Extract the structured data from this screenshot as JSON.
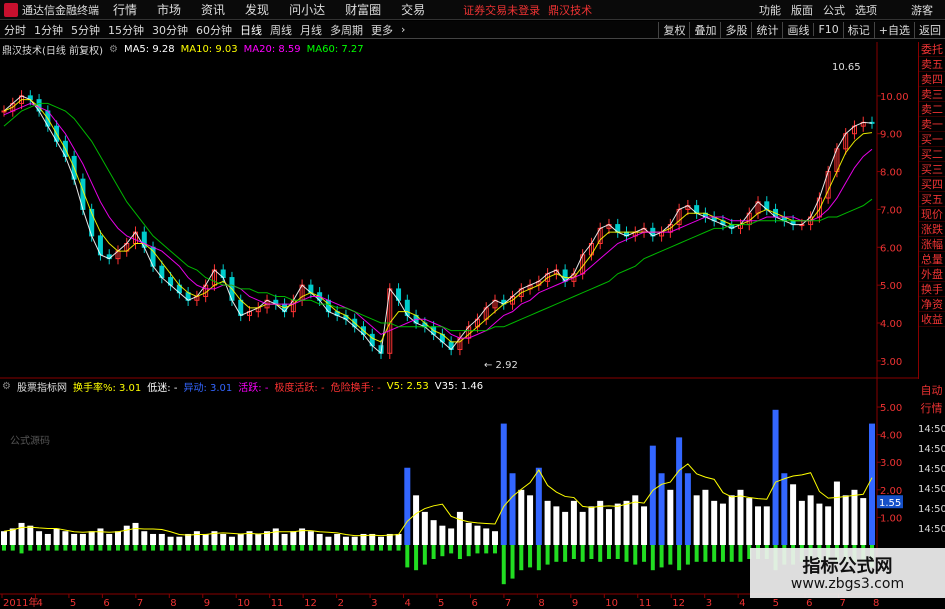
{
  "menubar": {
    "app_title": "通达信金融终端",
    "items": [
      "行情",
      "市场",
      "资讯",
      "发现",
      "问小达",
      "财富圈",
      "交易"
    ],
    "login_status": "证券交易未登录",
    "company": "鼎汉技术",
    "right_items": [
      "功能",
      "版面",
      "公式",
      "选项"
    ],
    "guest": "游客"
  },
  "toolbar": {
    "periods": [
      "分时",
      "1分钟",
      "5分钟",
      "15分钟",
      "30分钟",
      "60分钟",
      "日线",
      "周线",
      "月线",
      "多周期",
      "更多"
    ],
    "active": "日线",
    "right_buttons": [
      "复权",
      "叠加",
      "多股",
      "统计",
      "画线",
      "F10",
      "标记",
      "+自选",
      "返回"
    ]
  },
  "main_info": {
    "stock": "鼎汉技术(日线 前复权)",
    "ma5": "MA5: 9.28",
    "ma10": "MA10: 9.03",
    "ma20": "MA20: 8.59",
    "ma60": "MA60: 7.27"
  },
  "sub_info": {
    "name": "股票指标网",
    "turnover": "换手率%: 3.01",
    "low": "低迷: -",
    "move": "异动: 3.01",
    "active": "活跃: -",
    "very_active": "极度活跃: -",
    "warning": "危险换手: -",
    "v5": "V5: 2.53",
    "v35": "V35: 1.46",
    "formula_label": "公式源码"
  },
  "price_axis": [
    "10.00",
    "9.00",
    "8.00",
    "7.00",
    "6.00",
    "5.00",
    "4.00",
    "3.00"
  ],
  "sub_axis": [
    "5.00",
    "4.00",
    "3.00",
    "2.00",
    "1.00"
  ],
  "sub_axis_current": "1.55",
  "time_axis": [
    "2011年",
    "4",
    "5",
    "6",
    "7",
    "8",
    "9",
    "10",
    "11",
    "12",
    "2",
    "3",
    "4",
    "5",
    "6",
    "7",
    "8",
    "9",
    "10",
    "11",
    "12",
    "3",
    "4",
    "5",
    "6",
    "7",
    "8"
  ],
  "annotations": {
    "high": "10.65",
    "low": "2.92",
    "current_time_labels": [
      "14:50",
      "14:50",
      "14:50",
      "14:50",
      "14:50",
      "14:50"
    ]
  },
  "right_panel": [
    "委托",
    "卖五",
    "卖四",
    "卖三",
    "卖二",
    "卖一",
    "买一",
    "买二",
    "买三",
    "买四",
    "买五",
    "现价",
    "涨跌",
    "涨幅",
    "总量",
    "外盘",
    "换手",
    "净资",
    "收益"
  ],
  "right_panel2": [
    "自动",
    "行情"
  ],
  "watermark": {
    "title": "指标公式网",
    "url": "www.zbgs3.com"
  },
  "chart_data": {
    "type": "line",
    "title": "鼎汉技术(日线 前复权)",
    "ylim": [
      2.6,
      11.0
    ],
    "x": [
      0,
      1,
      2,
      3,
      4,
      5,
      6,
      7,
      8,
      9,
      10,
      11,
      12,
      13,
      14,
      15,
      16,
      17,
      18,
      19,
      20,
      21,
      22,
      23,
      24,
      25,
      26,
      27,
      28,
      29,
      30,
      31,
      32,
      33,
      34,
      35,
      36,
      37,
      38,
      39,
      40,
      41,
      42,
      43,
      44,
      45,
      46,
      47,
      48,
      49,
      50,
      51,
      52,
      53,
      54,
      55,
      56,
      57,
      58,
      59,
      60,
      61,
      62,
      63,
      64,
      65,
      66,
      67,
      68,
      69,
      70,
      71,
      72,
      73,
      74,
      75,
      76,
      77,
      78,
      79,
      80,
      81,
      82,
      83,
      84,
      85,
      86,
      87,
      88,
      89,
      90,
      91,
      92,
      93,
      94,
      95,
      96,
      97,
      98,
      99
    ],
    "series": [
      {
        "name": "MA5",
        "values": [
          9.6,
          9.8,
          10.0,
          9.9,
          9.6,
          9.2,
          8.8,
          8.4,
          7.8,
          7.0,
          6.3,
          5.8,
          5.7,
          5.9,
          6.1,
          6.4,
          6.0,
          5.5,
          5.2,
          5.0,
          4.8,
          4.6,
          4.7,
          5.0,
          5.4,
          5.2,
          4.6,
          4.2,
          4.3,
          4.4,
          4.6,
          4.5,
          4.3,
          4.6,
          5.0,
          4.8,
          4.6,
          4.3,
          4.2,
          4.1,
          3.9,
          3.7,
          3.4,
          3.2,
          4.9,
          4.6,
          4.2,
          4.0,
          3.9,
          3.7,
          3.5,
          3.3,
          3.6,
          3.9,
          4.1,
          4.4,
          4.6,
          4.5,
          4.7,
          4.9,
          5.0,
          5.1,
          5.3,
          5.4,
          5.1,
          5.3,
          5.8,
          6.1,
          6.5,
          6.6,
          6.4,
          6.3,
          6.4,
          6.5,
          6.3,
          6.4,
          6.6,
          7.0,
          7.1,
          6.9,
          6.8,
          6.7,
          6.6,
          6.5,
          6.6,
          6.9,
          7.2,
          7.0,
          6.8,
          6.7,
          6.6,
          6.6,
          6.8,
          7.3,
          8.0,
          8.6,
          9.0,
          9.2,
          9.3,
          9.28
        ]
      },
      {
        "name": "MA10",
        "values": [
          9.6,
          9.7,
          9.9,
          9.9,
          9.7,
          9.4,
          9.0,
          8.6,
          8.1,
          7.5,
          6.9,
          6.4,
          6.1,
          5.9,
          5.9,
          6.1,
          6.1,
          5.9,
          5.6,
          5.3,
          5.0,
          4.8,
          4.7,
          4.8,
          5.0,
          5.1,
          4.9,
          4.6,
          4.4,
          4.4,
          4.5,
          4.5,
          4.4,
          4.5,
          4.7,
          4.8,
          4.7,
          4.5,
          4.3,
          4.2,
          4.0,
          3.8,
          3.6,
          3.5,
          4.0,
          4.3,
          4.3,
          4.2,
          4.0,
          3.8,
          3.7,
          3.5,
          3.5,
          3.7,
          3.9,
          4.1,
          4.3,
          4.5,
          4.6,
          4.8,
          4.9,
          5.0,
          5.2,
          5.3,
          5.2,
          5.2,
          5.5,
          5.8,
          6.2,
          6.4,
          6.4,
          6.4,
          6.4,
          6.4,
          6.4,
          6.4,
          6.5,
          6.7,
          6.9,
          6.9,
          6.9,
          6.8,
          6.7,
          6.6,
          6.6,
          6.7,
          6.9,
          7.0,
          6.9,
          6.8,
          6.7,
          6.7,
          6.7,
          7.0,
          7.5,
          8.0,
          8.5,
          8.8,
          9.0,
          9.03
        ]
      },
      {
        "name": "MA20",
        "values": [
          9.5,
          9.6,
          9.7,
          9.8,
          9.7,
          9.6,
          9.3,
          9.0,
          8.6,
          8.2,
          7.7,
          7.2,
          6.8,
          6.5,
          6.3,
          6.2,
          6.1,
          6.0,
          5.9,
          5.7,
          5.5,
          5.2,
          5.0,
          4.9,
          4.9,
          5.0,
          5.0,
          4.9,
          4.7,
          4.6,
          4.5,
          4.5,
          4.5,
          4.5,
          4.6,
          4.7,
          4.7,
          4.6,
          4.5,
          4.4,
          4.3,
          4.1,
          3.9,
          3.7,
          3.8,
          3.9,
          4.0,
          4.1,
          4.1,
          4.0,
          3.9,
          3.7,
          3.6,
          3.6,
          3.7,
          3.8,
          4.0,
          4.2,
          4.3,
          4.5,
          4.6,
          4.8,
          4.9,
          5.0,
          5.1,
          5.2,
          5.3,
          5.5,
          5.7,
          5.9,
          6.1,
          6.2,
          6.3,
          6.4,
          6.4,
          6.4,
          6.4,
          6.5,
          6.6,
          6.7,
          6.8,
          6.8,
          6.8,
          6.7,
          6.7,
          6.7,
          6.7,
          6.8,
          6.8,
          6.8,
          6.8,
          6.7,
          6.7,
          6.8,
          7.0,
          7.3,
          7.7,
          8.1,
          8.4,
          8.59
        ]
      },
      {
        "name": "MA60",
        "values": [
          9.2,
          9.4,
          9.6,
          9.7,
          9.8,
          9.8,
          9.7,
          9.6,
          9.4,
          9.1,
          8.8,
          8.4,
          8.0,
          7.6,
          7.2,
          6.9,
          6.6,
          6.3,
          6.1,
          5.9,
          5.7,
          5.5,
          5.4,
          5.2,
          5.1,
          5.0,
          5.0,
          4.9,
          4.9,
          4.8,
          4.8,
          4.7,
          4.7,
          4.6,
          4.6,
          4.6,
          4.5,
          4.5,
          4.4,
          4.4,
          4.3,
          4.2,
          4.1,
          4.0,
          4.0,
          3.9,
          3.9,
          3.9,
          3.9,
          3.9,
          3.9,
          3.8,
          3.8,
          3.8,
          3.8,
          3.8,
          3.9,
          3.9,
          4.0,
          4.1,
          4.2,
          4.3,
          4.4,
          4.5,
          4.6,
          4.7,
          4.8,
          4.9,
          5.0,
          5.1,
          5.3,
          5.4,
          5.5,
          5.7,
          5.8,
          5.9,
          6.0,
          6.1,
          6.2,
          6.3,
          6.4,
          6.5,
          6.5,
          6.6,
          6.6,
          6.6,
          6.7,
          6.7,
          6.7,
          6.7,
          6.7,
          6.7,
          6.7,
          6.7,
          6.8,
          6.8,
          6.9,
          7.0,
          7.1,
          7.27
        ]
      }
    ],
    "turnover": {
      "values": [
        0.5,
        0.6,
        0.8,
        0.7,
        0.5,
        0.4,
        0.6,
        0.5,
        0.4,
        0.4,
        0.5,
        0.6,
        0.4,
        0.5,
        0.7,
        0.8,
        0.5,
        0.4,
        0.4,
        0.3,
        0.3,
        0.4,
        0.5,
        0.4,
        0.5,
        0.4,
        0.3,
        0.4,
        0.5,
        0.4,
        0.5,
        0.6,
        0.4,
        0.5,
        0.6,
        0.5,
        0.4,
        0.3,
        0.4,
        0.3,
        0.3,
        0.4,
        0.4,
        0.3,
        0.4,
        0.4,
        2.8,
        1.8,
        1.2,
        0.9,
        0.7,
        0.6,
        1.2,
        0.8,
        0.7,
        0.6,
        0.5,
        4.4,
        2.6,
        2.0,
        1.8,
        2.8,
        1.6,
        1.4,
        1.2,
        1.6,
        1.2,
        1.4,
        1.6,
        1.3,
        1.5,
        1.6,
        1.8,
        1.4,
        3.6,
        2.6,
        2.0,
        3.9,
        2.6,
        1.8,
        2.0,
        1.6,
        1.5,
        1.8,
        2.0,
        1.7,
        1.4,
        1.4,
        4.9,
        2.6,
        2.2,
        1.6,
        1.8,
        1.5,
        1.4,
        2.3,
        1.8,
        2.0,
        1.7,
        4.4
      ],
      "ylim": [
        0,
        5.4
      ],
      "negative": [
        0.2,
        0.2,
        0.3,
        0.2,
        0.2,
        0.2,
        0.2,
        0.2,
        0.2,
        0.2,
        0.2,
        0.2,
        0.2,
        0.2,
        0.2,
        0.2,
        0.2,
        0.2,
        0.2,
        0.2,
        0.2,
        0.2,
        0.2,
        0.2,
        0.2,
        0.2,
        0.2,
        0.2,
        0.2,
        0.2,
        0.2,
        0.2,
        0.2,
        0.2,
        0.2,
        0.2,
        0.2,
        0.2,
        0.2,
        0.2,
        0.2,
        0.2,
        0.2,
        0.2,
        0.2,
        0.2,
        0.8,
        0.9,
        0.7,
        0.5,
        0.4,
        0.3,
        0.5,
        0.4,
        0.3,
        0.3,
        0.3,
        1.4,
        1.2,
        0.9,
        0.8,
        0.9,
        0.7,
        0.6,
        0.6,
        0.5,
        0.6,
        0.5,
        0.6,
        0.5,
        0.5,
        0.6,
        0.7,
        0.6,
        0.9,
        0.8,
        0.7,
        0.9,
        0.7,
        0.6,
        0.6,
        0.6,
        0.6,
        0.6,
        0.6,
        0.5,
        0.5,
        0.5,
        0.9,
        0.7,
        0.7,
        0.6,
        0.6,
        0.6,
        0.5,
        0.6,
        0.6,
        0.6,
        0.6,
        0.8
      ]
    }
  }
}
